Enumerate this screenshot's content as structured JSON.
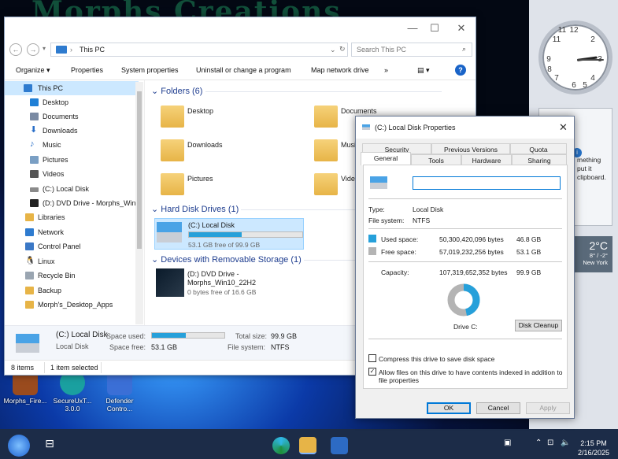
{
  "colors": {
    "accent": "#0078d7",
    "used": "#26a0da",
    "free": "#b4b4b4",
    "selection": "#cce8ff",
    "folder": "#e7b447"
  },
  "explorer": {
    "address": "This PC",
    "search_placeholder": "Search This PC",
    "toolbar": [
      "Organize ▾",
      "Properties",
      "System properties",
      "Uninstall or change a program",
      "Map network drive",
      "»"
    ],
    "nav": [
      {
        "label": "This PC",
        "icon": "computer-icon",
        "color": "#2e7bcf",
        "selected": true
      },
      {
        "label": "Desktop",
        "icon": "desktop-icon",
        "color": "#1f7fd6"
      },
      {
        "label": "Documents",
        "icon": "documents-icon",
        "color": "#7a8aa3"
      },
      {
        "label": "Downloads",
        "icon": "download-icon",
        "color": "#2a6fc9"
      },
      {
        "label": "Music",
        "icon": "music-icon",
        "color": "#2a6fc9"
      },
      {
        "label": "Pictures",
        "icon": "pictures-icon",
        "color": "#7a9fc4"
      },
      {
        "label": "Videos",
        "icon": "videos-icon",
        "color": "#555"
      },
      {
        "label": "(C:) Local Disk",
        "icon": "drive-icon",
        "color": "#8a8a8a"
      },
      {
        "label": "(D:) DVD Drive - Morphs_Win",
        "icon": "dvd-icon",
        "color": "#222"
      },
      {
        "label": "Libraries",
        "icon": "libraries-icon",
        "color": "#e7b447"
      },
      {
        "label": "Network",
        "icon": "network-icon",
        "color": "#2e7bcf"
      },
      {
        "label": "Control Panel",
        "icon": "control-panel-icon",
        "color": "#3b78c6"
      },
      {
        "label": "Linux",
        "icon": "linux-icon",
        "color": "#222"
      },
      {
        "label": "Recycle Bin",
        "icon": "recycle-bin-icon",
        "color": "#9aa5b1"
      },
      {
        "label": "Backup",
        "icon": "folder-icon",
        "color": "#e7b447"
      },
      {
        "label": "Morph's_Desktop_Apps",
        "icon": "folder-icon",
        "color": "#e7b447"
      }
    ],
    "groups": {
      "folders": "Folders (6)",
      "drives": "Hard Disk Drives (1)",
      "removable": "Devices with Removable Storage (1)"
    },
    "folders": [
      "Desktop",
      "Documents",
      "Downloads",
      "Music",
      "Pictures",
      "Videos"
    ],
    "drive_c": {
      "name": "(C:) Local Disk",
      "free_text": "53.1 GB free of 99.9 GB",
      "used_fraction": 0.468
    },
    "drive_d": {
      "name_line1": "(D:) DVD Drive -",
      "name_line2": "Morphs_Win10_22H2",
      "free_text": "0 bytes free of 16.6 GB"
    },
    "details": {
      "name": "(C:) Local Disk",
      "kind": "Local Disk",
      "space_used_label": "Space used:",
      "space_free_label": "Space free:",
      "space_free": "53.1 GB",
      "total_size_label": "Total size:",
      "total_size": "99.9 GB",
      "fs_label": "File system:",
      "fs": "NTFS",
      "used_fraction": 0.468
    },
    "status": {
      "items": "8 items",
      "selected": "1 item selected"
    }
  },
  "dialog": {
    "title": "(C:) Local Disk Properties",
    "tabs_row1": [
      "Security",
      "Previous Versions",
      "Quota"
    ],
    "tabs_row2": [
      "General",
      "Tools",
      "Hardware",
      "Sharing"
    ],
    "name_value": "",
    "type_label": "Type:",
    "type_value": "Local Disk",
    "fs_label": "File system:",
    "fs_value": "NTFS",
    "used_label": "Used space:",
    "used_bytes": "50,300,420,096 bytes",
    "used_gb": "46.8 GB",
    "free_label": "Free space:",
    "free_bytes": "57,019,232,256 bytes",
    "free_gb": "53.1 GB",
    "cap_label": "Capacity:",
    "cap_bytes": "107,319,652,352 bytes",
    "cap_gb": "99.9 GB",
    "drive_label": "Drive C:",
    "cleanup": "Disk Cleanup",
    "compress": "Compress this drive to save disk space",
    "index_line1": "Allow files on this drive to have contents indexed in addition to",
    "index_line2": "file properties",
    "ok": "OK",
    "cancel": "Cancel",
    "apply": "Apply",
    "used_fraction": 0.468
  },
  "desktop": {
    "icons": [
      {
        "label": "Morphs_Fire...",
        "color": "#9a4b1e"
      },
      {
        "label": "SecureUxT... 3.0.0",
        "color": "#1aa0a0"
      },
      {
        "label": "Defender Contro...",
        "color": "#3b6fd6"
      }
    ],
    "gadget_text": "mething\n put it\n clipboard.",
    "weather_temp": "2°C",
    "weather_range": "8° / -2°",
    "weather_city": "New York"
  },
  "taskbar": {
    "time": "2:15 PM",
    "date": "2/16/2025"
  }
}
